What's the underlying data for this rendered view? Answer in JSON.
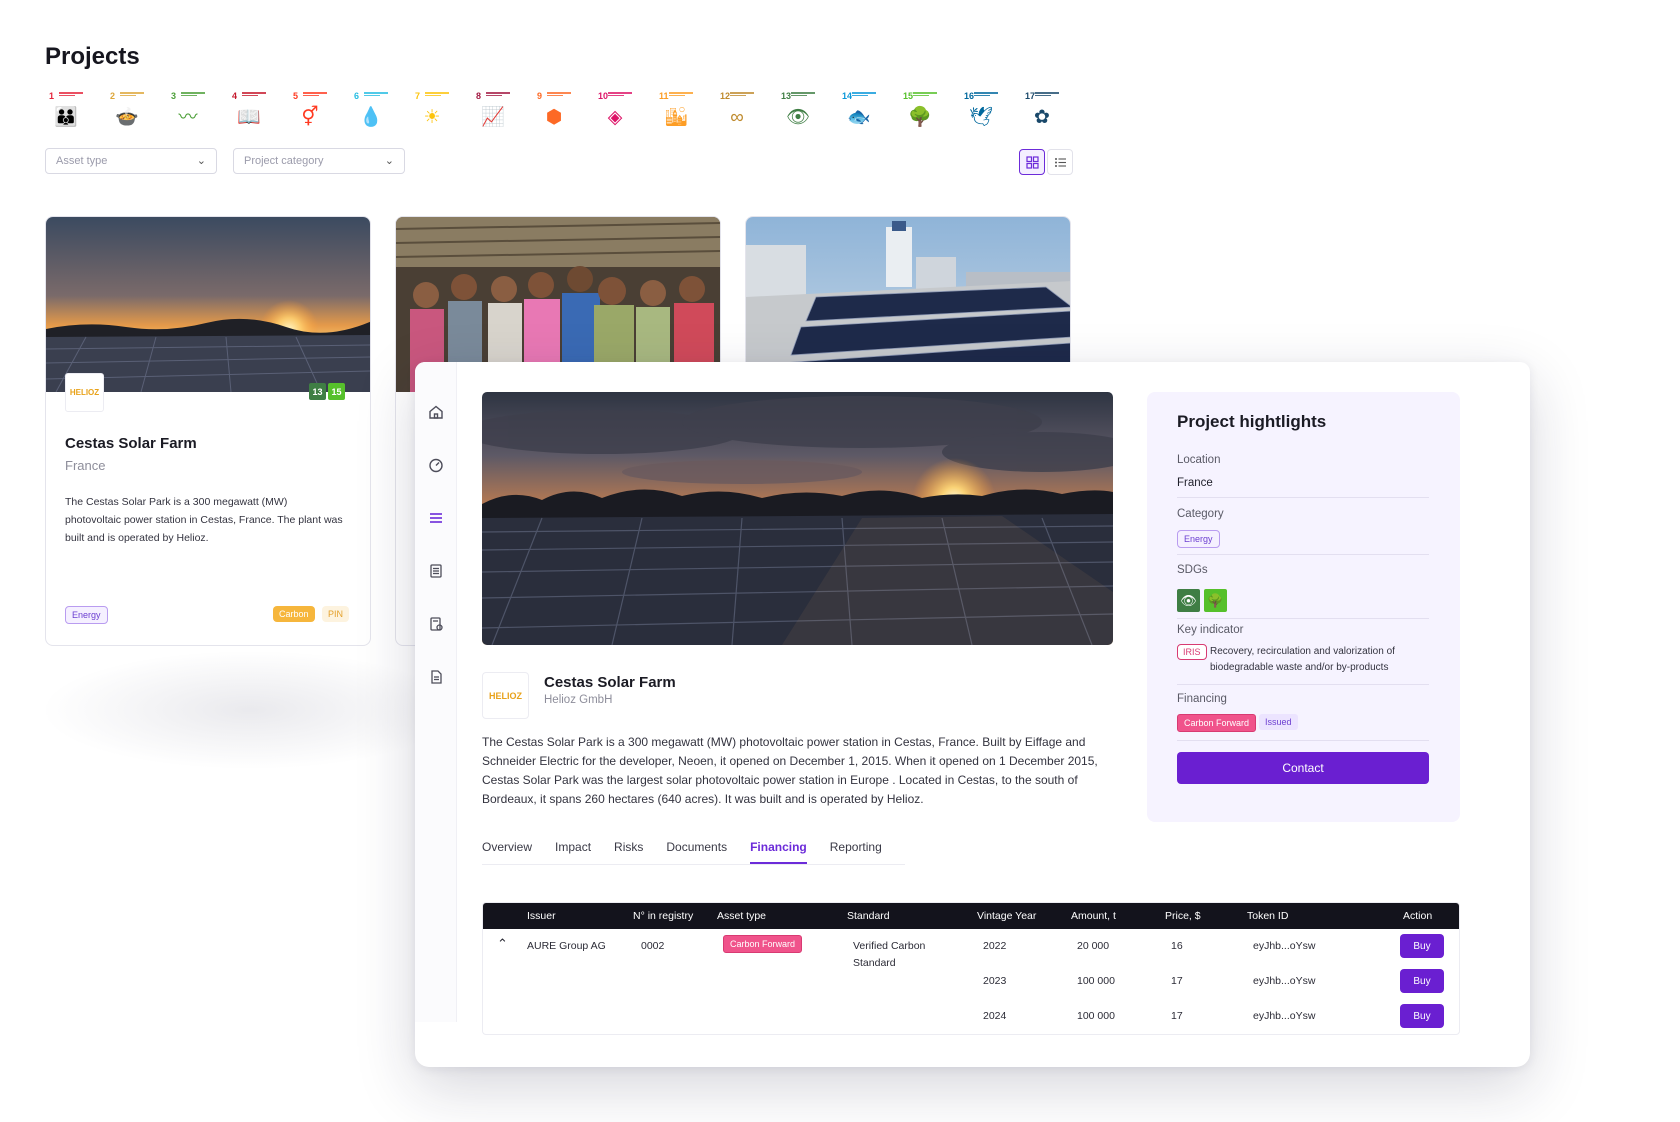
{
  "projects_page": {
    "title": "Projects",
    "sdg_icons": [
      {
        "num": "1",
        "color": "#e5243b",
        "icon": "people-icon",
        "glyph": "👪"
      },
      {
        "num": "2",
        "color": "#dda63a",
        "icon": "bowl-icon",
        "glyph": "🍲"
      },
      {
        "num": "3",
        "color": "#4c9f38",
        "icon": "heartbeat-icon",
        "glyph": "〰"
      },
      {
        "num": "4",
        "color": "#c5192d",
        "icon": "book-icon",
        "glyph": "📖"
      },
      {
        "num": "5",
        "color": "#ff3a21",
        "icon": "gender-icon",
        "glyph": "⚥"
      },
      {
        "num": "6",
        "color": "#26bde2",
        "icon": "water-drop-icon",
        "glyph": "💧"
      },
      {
        "num": "7",
        "color": "#fcc30b",
        "icon": "sun-icon",
        "glyph": "☀"
      },
      {
        "num": "8",
        "color": "#a21942",
        "icon": "growth-chart-icon",
        "glyph": "📈"
      },
      {
        "num": "9",
        "color": "#fd6925",
        "icon": "cubes-icon",
        "glyph": "⬢"
      },
      {
        "num": "10",
        "color": "#dd1367",
        "icon": "equality-icon",
        "glyph": "◈"
      },
      {
        "num": "11",
        "color": "#fd9d24",
        "icon": "city-icon",
        "glyph": "🏙"
      },
      {
        "num": "12",
        "color": "#bf8b2e",
        "icon": "infinity-icon",
        "glyph": "∞"
      },
      {
        "num": "13",
        "color": "#3f7e44",
        "icon": "eye-earth-icon",
        "glyph": "👁"
      },
      {
        "num": "14",
        "color": "#0a97d9",
        "icon": "fish-icon",
        "glyph": "🐟"
      },
      {
        "num": "15",
        "color": "#56c02b",
        "icon": "tree-icon",
        "glyph": "🌳"
      },
      {
        "num": "16",
        "color": "#00689d",
        "icon": "dove-icon",
        "glyph": "🕊"
      },
      {
        "num": "17",
        "color": "#19486a",
        "icon": "flower-icon",
        "glyph": "✿"
      }
    ],
    "filters": {
      "asset_type_placeholder": "Asset type",
      "project_category_placeholder": "Project category"
    },
    "cards": [
      {
        "logo": "HELIOZ",
        "sdgs": [
          "13",
          "15"
        ],
        "title": "Cestas Solar Farm",
        "country": "France",
        "description": "The Cestas Solar Park is a 300 megawatt (MW) photovoltaic power station in Cestas, France. The plant was built and is operated by Helioz.",
        "category": "Energy",
        "tags": [
          "Carbon",
          "PIN"
        ]
      }
    ]
  },
  "detail": {
    "title": "Cestas Solar Farm",
    "organization": "Helioz GmbH",
    "logo": "HELIOZ",
    "description": "The Cestas Solar Park is a 300 megawatt (MW) photovoltaic power station in Cestas, France. Built by Eiffage and Schneider Electric for the developer, Neoen, it opened on December 1, 2015. When it opened on 1 December 2015, Cestas Solar Park was the largest solar photovoltaic power station in Europe . Located in Cestas, to the south of Bordeaux, it spans 260 hectares (640 acres). It was built and is operated by Helioz.",
    "tabs": [
      "Overview",
      "Impact",
      "Risks",
      "Documents",
      "Financing",
      "Reporting"
    ],
    "active_tab": "Financing",
    "table": {
      "headers": [
        "Issuer",
        "N° in registry",
        "Asset type",
        "Standard",
        "Vintage Year",
        "Amount, t",
        "Price, $",
        "Token ID",
        "Action"
      ],
      "issuer": "AURE Group AG",
      "registry_no": "0002",
      "asset_type": "Carbon Forward",
      "standard_line1": "Verified Carbon",
      "standard_line2": "Standard",
      "rows": [
        {
          "year": "2022",
          "amount": "20 000",
          "price": "16",
          "token": "eyJhb...oYsw",
          "action": "Buy"
        },
        {
          "year": "2023",
          "amount": "100 000",
          "price": "17",
          "token": "eyJhb...oYsw",
          "action": "Buy"
        },
        {
          "year": "2024",
          "amount": "100 000",
          "price": "17",
          "token": "eyJhb...oYsw",
          "action": "Buy"
        }
      ]
    },
    "highlights": {
      "title": "Project hightlights",
      "location_label": "Location",
      "location_value": "France",
      "category_label": "Category",
      "category_value": "Energy",
      "sdgs_label": "SDGs",
      "sdgs": [
        "13",
        "15"
      ],
      "key_indicator_label": "Key indicator",
      "key_indicator_tag": "IRIS",
      "key_indicator_line1": "Recovery, recirculation and valorization of",
      "key_indicator_line2": "biodegradable waste and/or by-products",
      "financing_label": "Financing",
      "financing_tags": [
        "Carbon Forward",
        "Issued"
      ],
      "contact_label": "Contact"
    }
  },
  "colors": {
    "accent": "#6a1fd1",
    "accent_light": "#f6f3ff",
    "carbon_forward": "#f0538b",
    "carbon": "#f6b63c",
    "table_header": "#13131c"
  }
}
